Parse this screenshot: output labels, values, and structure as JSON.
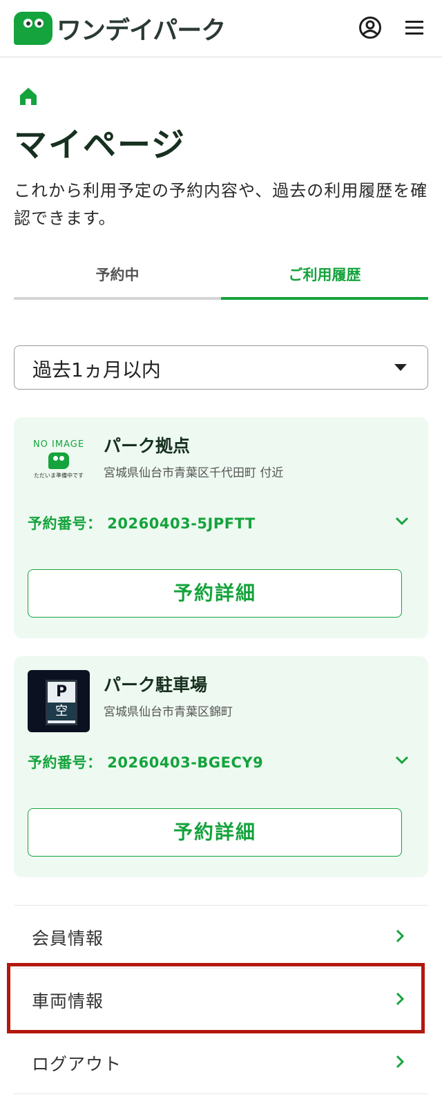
{
  "header": {
    "logo_text": "ワンデイパーク",
    "icons": {
      "account": "account-circle-icon",
      "menu": "hamburger-menu-icon"
    }
  },
  "breadcrumb": {
    "home_icon": "home-icon"
  },
  "page": {
    "title": "マイページ",
    "description": "これから利用予定の予約内容や、過去の利用履歴を確認できます。"
  },
  "tabs": [
    {
      "label": "予約中",
      "active": false
    },
    {
      "label": "ご利用履歴",
      "active": true
    }
  ],
  "filter": {
    "selected": "過去1ヵ月以内"
  },
  "reservations": [
    {
      "image_label_top": "NO IMAGE",
      "image_label_bottom": "ただいま準備中です",
      "name": "パーク拠点",
      "address": "宮城県仙台市青葉区千代田町 付近",
      "number_label": "予約番号： 20260403-5JPFTT",
      "detail_label": "予約詳細"
    },
    {
      "image_sign_p": "P",
      "image_sign_k": "空",
      "name": "パーク駐車場",
      "address": "宮城県仙台市青葉区錦町",
      "number_label": "予約番号： 20260403-BGECY9",
      "detail_label": "予約詳細"
    }
  ],
  "menu": [
    {
      "label": "会員情報"
    },
    {
      "label": "車両情報",
      "highlighted": true
    },
    {
      "label": "ログアウト"
    }
  ],
  "colors": {
    "brand_green": "#14a33c",
    "card_bg": "#eef9f1",
    "highlight_red": "#b3180c"
  }
}
